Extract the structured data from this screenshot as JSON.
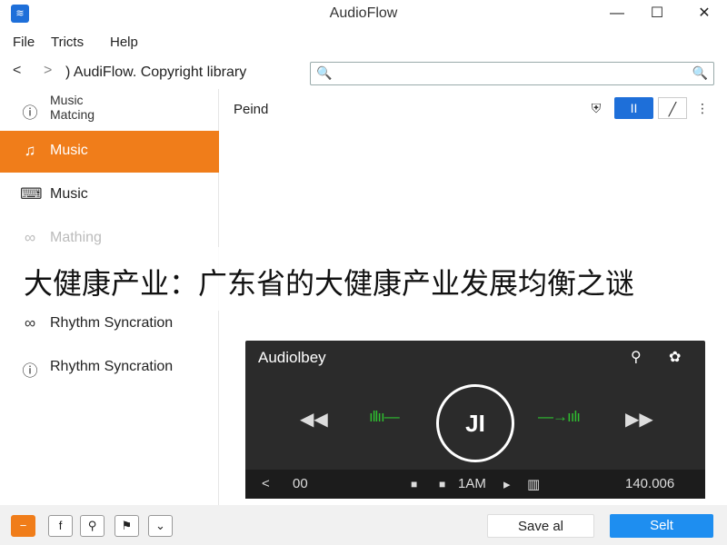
{
  "window": {
    "title": "AudioFlow",
    "app_icon": "audio-app-icon",
    "min_label": "—",
    "max_label": "☐",
    "close_label": "✕"
  },
  "menu": {
    "items": [
      "File",
      "Tricts",
      "Help"
    ]
  },
  "nav": {
    "back_label": "<",
    "forward_label": ">",
    "path": ") AudiFlow. Copyright library",
    "search_placeholder": "",
    "search_icon_label": "🔍",
    "search_icon_right_label": "🔍"
  },
  "sidebar": {
    "items": [
      {
        "icon": "info-circle-icon",
        "glyph": "ⓘ",
        "label_line1": "Music",
        "label_line2": "Matcing"
      },
      {
        "icon": "music-note-icon",
        "glyph": "♫",
        "label": "Music"
      },
      {
        "icon": "keyboard-icon",
        "glyph": "⌨",
        "label": "Music"
      },
      {
        "icon": "link-icon",
        "glyph": "∞",
        "label": "Mathing"
      },
      {
        "icon": "link-icon",
        "glyph": "∞",
        "label": "Rhythm Syncration"
      },
      {
        "icon": "alert-circle-icon",
        "glyph": "ⓘ",
        "label": "Rhythm Syncration"
      }
    ]
  },
  "main": {
    "title": "Peind",
    "toolbar": {
      "shield_label": "⛨",
      "pause_label": "II",
      "edit_label": "╱",
      "more_label": "⋮"
    }
  },
  "banner": {
    "text": "大健康产业：广东省的大健康产业发展均衡之谜"
  },
  "player": {
    "title": "Audiolbey",
    "search_label": "⚲",
    "settings_label": "✿",
    "rewind_label": "◀◀",
    "wave_left": "ıllıı—",
    "play_label": "JI",
    "wave_right": "—→ıılı",
    "forward_label": "▶▶",
    "status": {
      "back_label": "<",
      "time": "00",
      "stop_label": "■",
      "stop2_label": "■",
      "mode": "1AM",
      "arrow_label": "▸",
      "grid_label": "▥",
      "total": "140.006"
    }
  },
  "bottom": {
    "minus_label": "−",
    "f_label": "f",
    "wrench_label": "⚲",
    "flag_label": "⚑",
    "chevron_label": "⌄",
    "save_all_label": "Save al",
    "select_label": "Selt"
  },
  "colors": {
    "accent": "#f07d1a",
    "primary": "#1e6fd9",
    "player_bg": "#2b2b2b",
    "wave": "#2fbf30"
  }
}
